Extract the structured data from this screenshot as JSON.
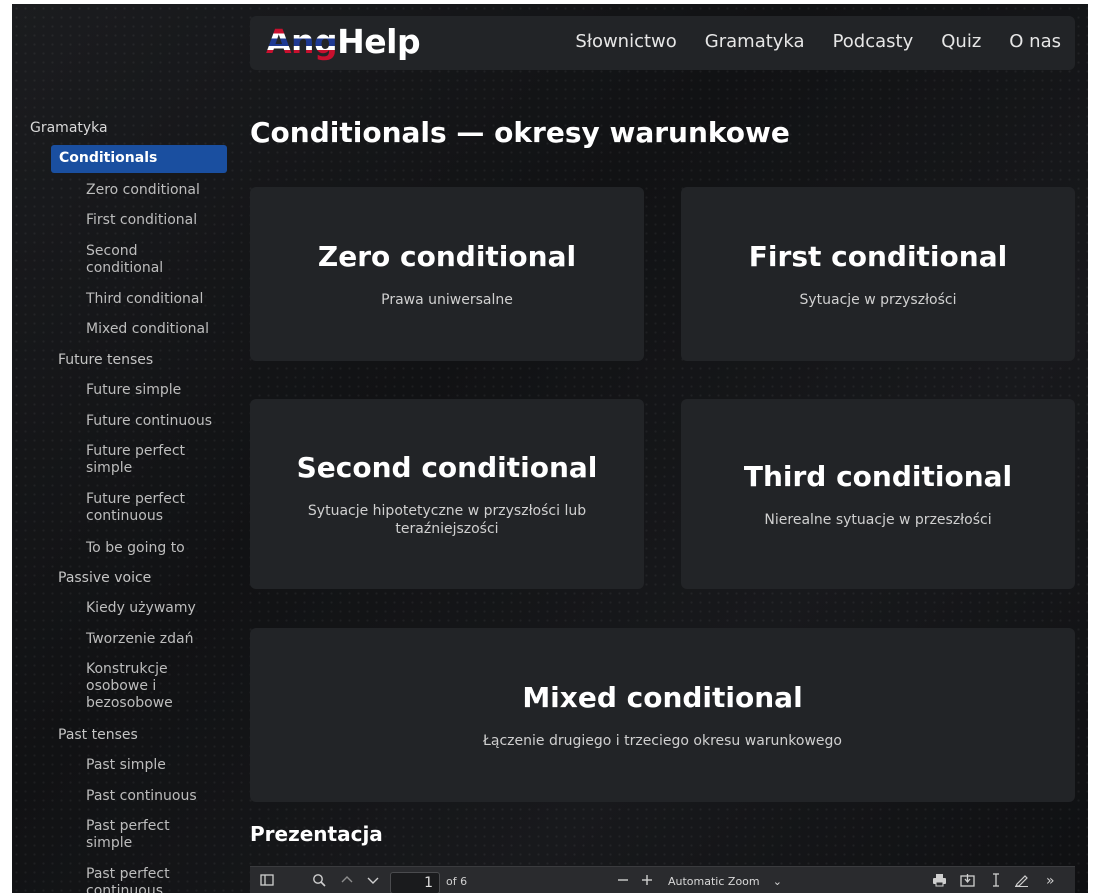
{
  "header": {
    "logo_ang": "Ang",
    "logo_help": "Help",
    "nav": [
      "Słownictwo",
      "Gramatyka",
      "Podcasty",
      "Quiz",
      "O nas"
    ]
  },
  "sidebar": {
    "root": "Gramatyka",
    "items": [
      {
        "label": "Conditionals",
        "level": 1,
        "active": true
      },
      {
        "label": "Zero conditional",
        "level": 2
      },
      {
        "label": "First conditional",
        "level": 2
      },
      {
        "label": "Second conditional",
        "level": 2
      },
      {
        "label": "Third conditional",
        "level": 2
      },
      {
        "label": "Mixed conditional",
        "level": 2
      },
      {
        "label": "Future tenses",
        "level": 1
      },
      {
        "label": "Future simple",
        "level": 2
      },
      {
        "label": "Future continuous",
        "level": 2
      },
      {
        "label": "Future perfect simple",
        "level": 2
      },
      {
        "label": "Future perfect continuous",
        "level": 2
      },
      {
        "label": "To be going to",
        "level": 2
      },
      {
        "label": "Passive voice",
        "level": 1
      },
      {
        "label": "Kiedy używamy",
        "level": 2
      },
      {
        "label": "Tworzenie zdań",
        "level": 2
      },
      {
        "label": "Konstrukcje osobowe i bezosobowe",
        "level": 2
      },
      {
        "label": "Past tenses",
        "level": 1
      },
      {
        "label": "Past simple",
        "level": 2
      },
      {
        "label": "Past continuous",
        "level": 2
      },
      {
        "label": "Past perfect simple",
        "level": 2
      },
      {
        "label": "Past perfect continuous",
        "level": 2
      }
    ]
  },
  "main": {
    "title": "Conditionals — okresy warunkowe",
    "cards": [
      {
        "title": "Zero conditional",
        "desc": "Prawa uniwersalne"
      },
      {
        "title": "First conditional",
        "desc": "Sytuacje w przyszłości"
      },
      {
        "title": "Second conditional",
        "desc": "Sytuacje hipotetyczne w przyszłości lub teraźniejszości"
      },
      {
        "title": "Third conditional",
        "desc": "Nierealne sytuacje w przeszłości"
      },
      {
        "title": "Mixed conditional",
        "desc": "Łączenie drugiego i trzeciego okresu warunkowego"
      }
    ],
    "section_title": "Prezentacja"
  },
  "pdf_toolbar": {
    "page_number": "1",
    "page_count": "of 6",
    "zoom": "Automatic Zoom",
    "icons": [
      "sidebar-toggle-icon",
      "search-icon",
      "chevron-up-icon",
      "chevron-down-icon",
      "zoom-out-icon",
      "zoom-in-icon",
      "print-icon",
      "download-icon",
      "text-cursor-icon",
      "pen-icon",
      "more-tools-icon"
    ]
  }
}
